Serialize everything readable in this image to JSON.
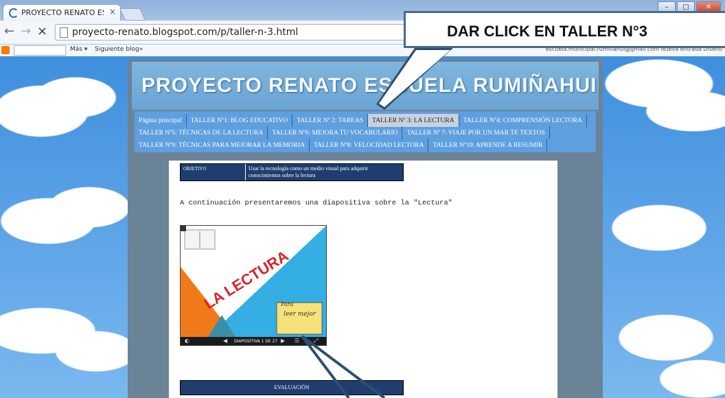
{
  "browser": {
    "tab_title": "PROYECTO RENATO ESCU",
    "tab_close": "×",
    "url": "proyecto-renato.blogspot.com/p/taller-n-3.html",
    "back_icon": "back-arrow-icon",
    "forward_icon": "forward-arrow-icon",
    "stop_icon": "×",
    "win_min": "–",
    "win_max": "□",
    "win_close": "✕"
  },
  "bookmarks": {
    "more": "Más ▾",
    "next": "Siguiente blog»",
    "right": "escuela.municipal.rumiñahui@gmail.com   Nueva entrada   Diseño"
  },
  "blog": {
    "title": "PROYECTO RENATO ESCUELA RUMIÑAHUI",
    "tabs_row1": [
      "Página principal",
      "TALLER Nº1: BLOG EDUCATIVO",
      "TALLER Nº 2: TAREAS",
      "TALLER Nº 3: LA LECTURA",
      "TALLER Nº4: COMPRENSIÓN LECTORA"
    ],
    "tabs_row2": [
      "TALLER Nº5: TÉCNICAS DE LA LECTURA",
      "TALLER Nº6: MEJORA TU VOCABULARIO",
      "TALLER Nº 7: VIAJE POR UN MAR TE TEXTOS"
    ],
    "tabs_row3": [
      "TALLER Nº9: TÉCNICAS PARA MEJORAR LA MEMORIA",
      "TALLER Nº8: VELOCIDAD LECTORA",
      "TALLER Nº10: APRENDE A RESUMIR"
    ]
  },
  "content": {
    "objective_label": "Objetivo",
    "objective_text": "Usar la tecnología como un medio visual para adquirir conocimientos sobre la lectura",
    "intro": "A continuación presentaremos una diapositiva  sobre la \"Lectura\"",
    "slide_title": "LA LECTURA",
    "slide_caption_1": "Para",
    "slide_caption_2": "leer mejor",
    "slide_counter": "DIAPOSITIVA 1 DE 27",
    "evaluation": "EVALUACIÓN"
  },
  "annotation": {
    "text": "DAR CLICK EN TALLER N°3"
  },
  "colors": {
    "nav_bg": "#5e9fe0",
    "table_bg": "#1f3d6e",
    "slide_blue": "#34aee3",
    "slide_orange": "#f07a1a",
    "arrow": "#2f4f6f"
  }
}
